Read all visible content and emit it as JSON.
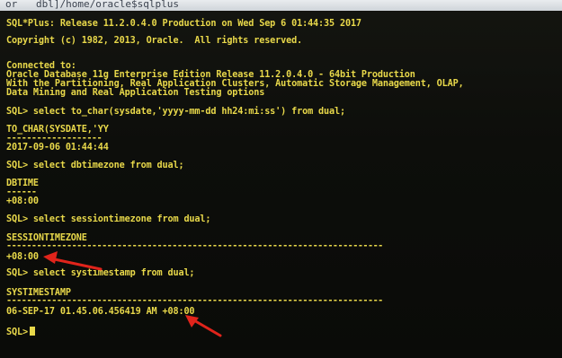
{
  "window": {
    "title": "dbl]/home/oracle$sqlplus",
    "title_prefix": "or"
  },
  "terminal": {
    "banner_line": "SQL*Plus: Release 11.2.0.4.0 Production on Wed Sep 6 01:44:35 2017",
    "copyright_line": "Copyright (c) 1982, 2013, Oracle.  All rights reserved.",
    "connected_to": "Connected to:",
    "db_line1": "Oracle Database 11g Enterprise Edition Release 11.2.0.4.0 - 64bit Production",
    "db_line2": "With the Partitioning, Real Application Clusters, Automatic Storage Management, OLAP,",
    "db_line3": "Data Mining and Real Application Testing options",
    "query1": "SQL> select to_char(sysdate,'yyyy-mm-dd hh24:mi:ss') from dual;",
    "query1_header": "TO_CHAR(SYSDATE,'YY",
    "query1_rule": "-------------------",
    "query1_value": "2017-09-06 01:44:44",
    "query2": "SQL> select dbtimezone from dual;",
    "query2_header": "DBTIME",
    "query2_rule": "------",
    "query2_value": "+08:00",
    "query3": "SQL> select sessiontimezone from dual;",
    "query3_header": "SESSIONTIMEZONE",
    "query3_rule": "---------------------------------------------------------------------------",
    "query3_value": "+08:00",
    "query4": "SQL> select systimestamp from dual;",
    "query4_header": "SYSTIMESTAMP",
    "query4_rule": "---------------------------------------------------------------------------",
    "query4_value": "06-SEP-17 01.45.06.456419 AM +08:00",
    "prompt": "SQL>"
  },
  "colors": {
    "text": "#e8d84a",
    "background": "#0c0d0a",
    "arrow": "#e0241b"
  }
}
